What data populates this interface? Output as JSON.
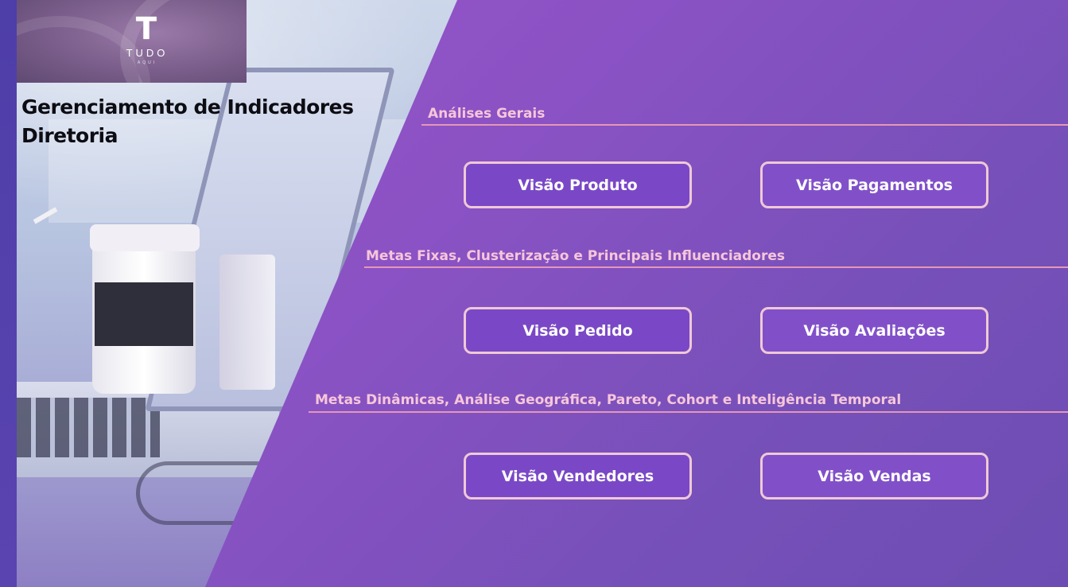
{
  "brand": {
    "logo_mark": "T",
    "name": "TUDO",
    "tagline": "AQUI"
  },
  "header": {
    "title_line1": "Gerenciamento de Indicadores",
    "title_line2": "Diretoria"
  },
  "sections": [
    {
      "label": "Análises Gerais",
      "buttons": [
        "Visão Produto",
        "Visão Pagamentos"
      ]
    },
    {
      "label": "Metas Fixas, Clusterização e Principais Influenciadores",
      "buttons": [
        "Visão Pedido",
        "Visão Avaliações"
      ]
    },
    {
      "label": "Metas Dinâmicas, Análise Geográfica, Pareto, Cohort e Inteligência Temporal",
      "buttons": [
        "Visão Vendedores",
        "Visão Vendas"
      ]
    }
  ],
  "colors": {
    "panel_purple": "#8a52c4",
    "section_label": "#f7c6d9",
    "button_fill": "#7a48c6",
    "button_border": "#efc9d6"
  }
}
